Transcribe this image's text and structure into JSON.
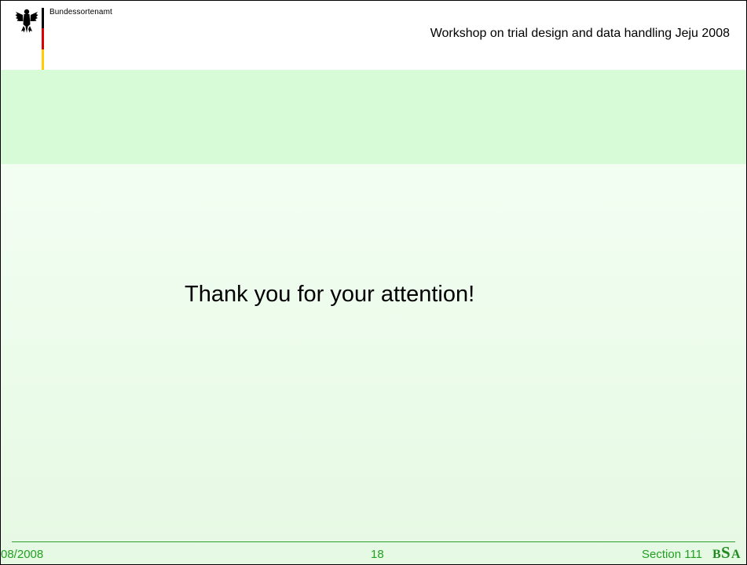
{
  "header": {
    "agency": "Bundessortenamt",
    "workshop_title": "Workshop on trial design and data handling Jeju 2008"
  },
  "main": {
    "message": "Thank you for your attention!"
  },
  "footer": {
    "date": "08/2008",
    "page_number": "18",
    "section": "Section 111",
    "logo_text": "BSA"
  },
  "colors": {
    "header_band": "#d7fbd7",
    "body_band": "#e6f9e3",
    "footer_text": "#22a022",
    "flag_black": "#000000",
    "flag_red": "#dd0000",
    "flag_gold": "#ffcc00"
  },
  "icons": {
    "emblem": "federal-eagle-icon",
    "logo": "bsa-logo"
  }
}
